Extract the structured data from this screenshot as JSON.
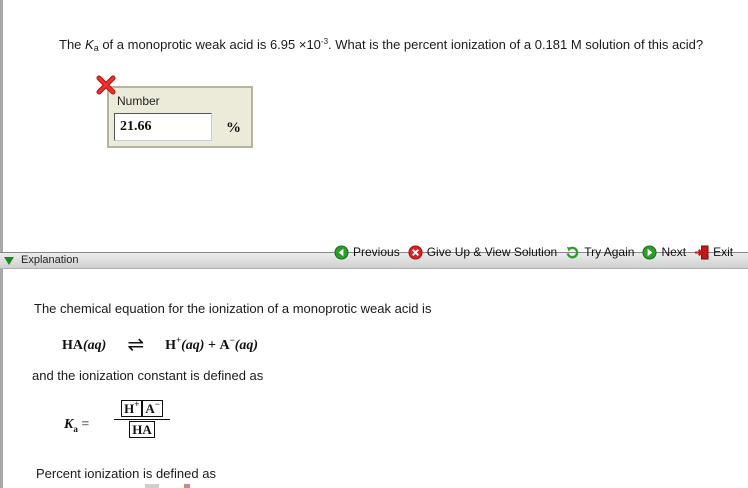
{
  "question": {
    "pre": "The ",
    "k": "K",
    "k_sub": "a",
    "mid": " of a monoprotic weak acid is 6.95 ×10",
    "exp": "-3",
    "post": ". What is the percent ionization of a 0.181 M solution of this acid?"
  },
  "answer": {
    "label": "Number",
    "value": "21.66",
    "unit": "%",
    "status_icon": "red-x-incorrect-icon"
  },
  "toolbar": {
    "previous": "Previous",
    "give_up": "Give Up & View Solution",
    "try_again": "Try Again",
    "next": "Next",
    "exit": "Exit"
  },
  "explanation": {
    "header": "Explanation",
    "p1": "The chemical equation for the ionization of a monoprotic weak acid is",
    "eq1": {
      "reactant": "HA",
      "reactant_state": "(aq)",
      "arrow": "⇌",
      "p1": "H",
      "p1_charge": "+",
      "p1_state": "(aq)",
      "plus": "+",
      "p2": "A",
      "p2_charge": "−",
      "p2_state": "(aq)"
    },
    "p2": "and the ionization constant is defined as",
    "eq2": {
      "lhs": "K",
      "lhs_sub": "a",
      "equals": "=",
      "num_h": "H",
      "num_h_charge": "+",
      "num_a": "A",
      "num_a_charge": "−",
      "den": "HA"
    },
    "p3": "Percent ionization is defined as"
  },
  "colors": {
    "answer_box_bg": "#ecebd9",
    "explanation_triangle": "#1c8a1c",
    "error_red": "#e02020",
    "nav_green": "#2aa02a"
  }
}
